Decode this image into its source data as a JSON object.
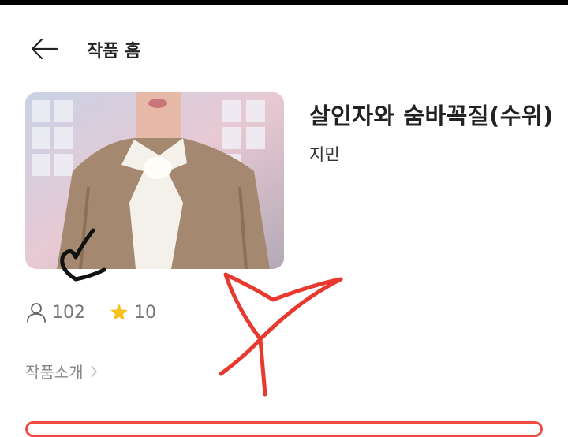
{
  "header": {
    "title": "작품 홈"
  },
  "work": {
    "title": "살인자와 숨바꼭질(수위)",
    "author": "지민"
  },
  "stats": {
    "readers": "102",
    "stars": "10"
  },
  "intro": {
    "label": "작품소개"
  },
  "colors": {
    "accent_red": "#ef4b3f",
    "star_yellow": "#f6c21c"
  },
  "icons": [
    "back-arrow-icon",
    "user-icon",
    "star-icon",
    "chevron-right-icon"
  ]
}
